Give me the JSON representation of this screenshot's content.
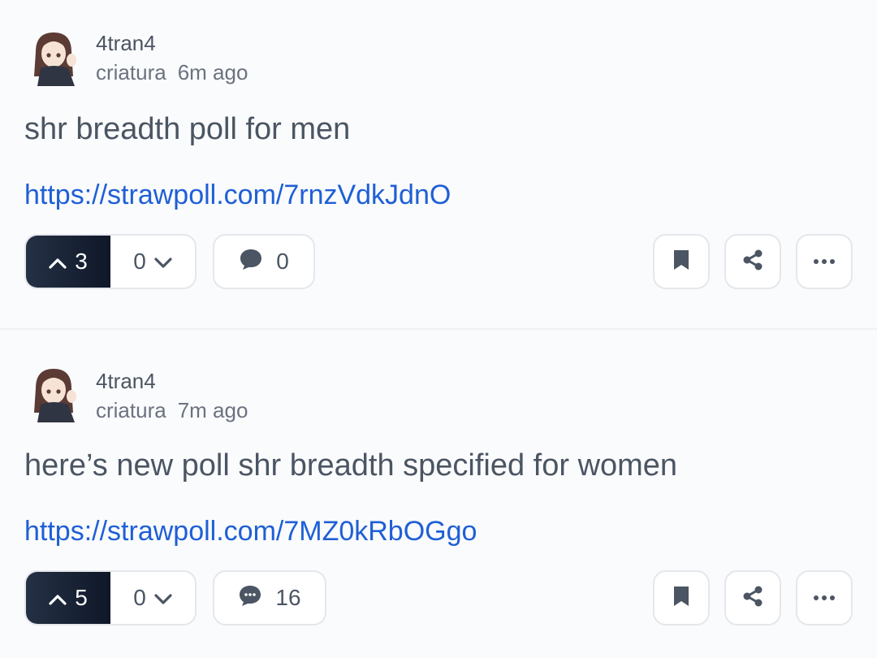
{
  "posts": [
    {
      "author": "4tran4",
      "community": "criatura",
      "time": "6m ago",
      "title": "shr breadth poll for men",
      "link": "https://strawpoll.com/7rnzVdkJdnO",
      "upvotes": "3",
      "downvotes": "0",
      "comments": "0"
    },
    {
      "author": "4tran4",
      "community": "criatura",
      "time": "7m ago",
      "title": "here’s new poll shr breadth specified for women",
      "link": "https://strawpoll.com/7MZ0kRbOGgo",
      "upvotes": "5",
      "downvotes": "0",
      "comments": "16"
    }
  ],
  "colors": {
    "accent": "#1f5fd6",
    "upvote_bg": "#172033"
  },
  "icons": [
    "avatar",
    "chevron-up-icon",
    "chevron-down-icon",
    "comment-icon",
    "bookmark-icon",
    "share-icon",
    "more-icon"
  ]
}
